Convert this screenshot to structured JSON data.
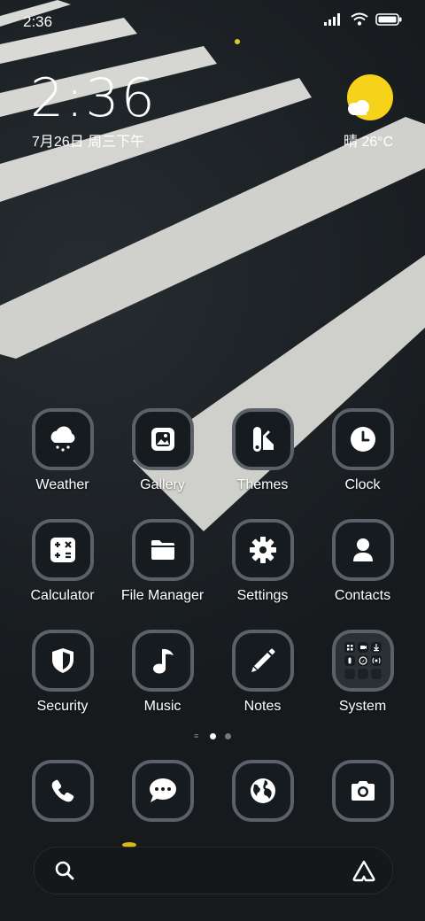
{
  "status_bar": {
    "time": "2:36"
  },
  "clock_widget": {
    "time": "2:36",
    "date": "7月26日 周三下午"
  },
  "weather_widget": {
    "text": "晴 26°C"
  },
  "apps": [
    {
      "label": "Weather",
      "icon": "weather-icon"
    },
    {
      "label": "Gallery",
      "icon": "gallery-icon"
    },
    {
      "label": "Themes",
      "icon": "themes-icon"
    },
    {
      "label": "Clock",
      "icon": "clock-icon"
    },
    {
      "label": "Calculator",
      "icon": "calculator-icon"
    },
    {
      "label": "File Manager",
      "icon": "folder-icon"
    },
    {
      "label": "Settings",
      "icon": "gear-icon"
    },
    {
      "label": "Contacts",
      "icon": "contacts-icon"
    },
    {
      "label": "Security",
      "icon": "shield-icon"
    },
    {
      "label": "Music",
      "icon": "music-icon"
    },
    {
      "label": "Notes",
      "icon": "pencil-icon"
    },
    {
      "label": "System",
      "icon": "system-folder-icon"
    }
  ],
  "dock": [
    {
      "icon": "phone-icon"
    },
    {
      "icon": "message-icon"
    },
    {
      "icon": "browser-icon"
    },
    {
      "icon": "camera-icon"
    }
  ],
  "page_indicator": {
    "pages": 2,
    "current": 1
  },
  "colors": {
    "icon_border": "#5a6169",
    "sun": "#f7d21a"
  }
}
